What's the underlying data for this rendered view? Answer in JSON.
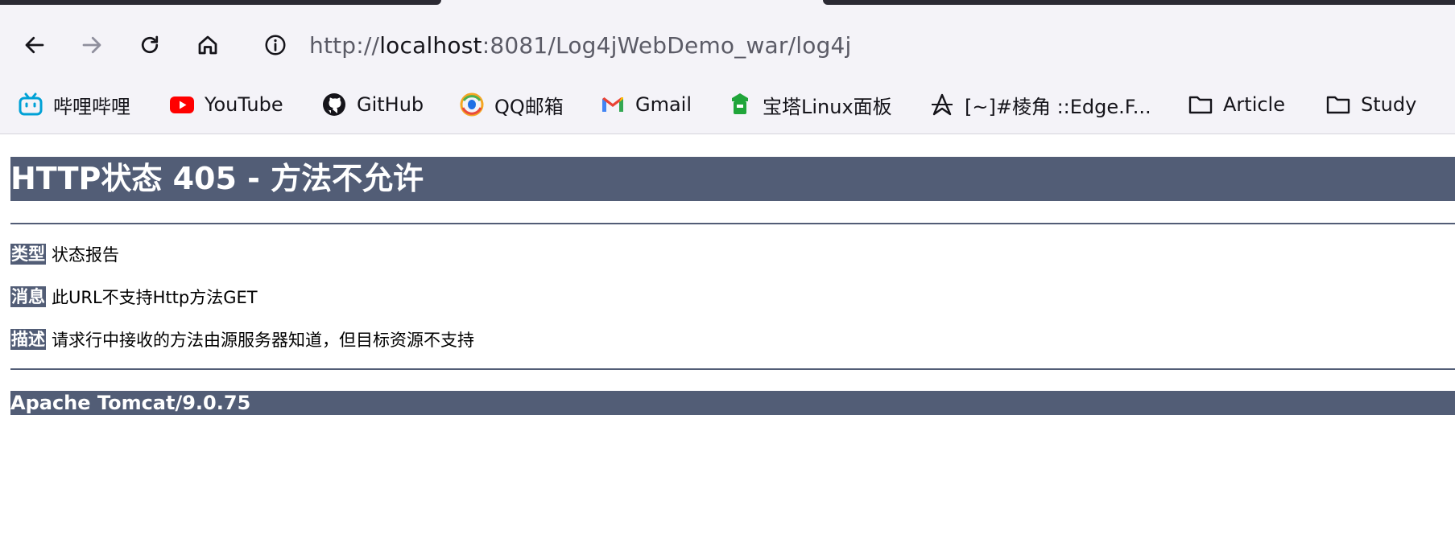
{
  "browser": {
    "url": {
      "scheme": "http://",
      "host": "localhost",
      "rest": ":8081/Log4jWebDemo_war/log4j"
    },
    "bookmarks": [
      {
        "label": "哔哩哔哩",
        "icon": "bilibili-icon"
      },
      {
        "label": "YouTube",
        "icon": "youtube-icon"
      },
      {
        "label": "GitHub",
        "icon": "github-icon"
      },
      {
        "label": "QQ邮箱",
        "icon": "qqmail-icon"
      },
      {
        "label": "Gmail",
        "icon": "gmail-icon"
      },
      {
        "label": "宝塔Linux面板",
        "icon": "baota-icon"
      },
      {
        "label": "[~]#棱角 ::Edge.F...",
        "icon": "edge-forum-icon"
      },
      {
        "label": "Article",
        "icon": "folder-icon"
      },
      {
        "label": "Study",
        "icon": "folder-icon"
      }
    ]
  },
  "page": {
    "title": "HTTP状态 405 - 方法不允许",
    "type_label": "类型",
    "type_value": "状态报告",
    "message_label": "消息",
    "message_value": "此URL不支持Http方法GET",
    "description_label": "描述",
    "description_value": "请求行中接收的方法由源服务器知道，但目标资源不支持",
    "footer": "Apache Tomcat/9.0.75"
  },
  "colors": {
    "tomcat_header_bg": "#525d76",
    "chrome_bg": "#f4f3f8"
  }
}
